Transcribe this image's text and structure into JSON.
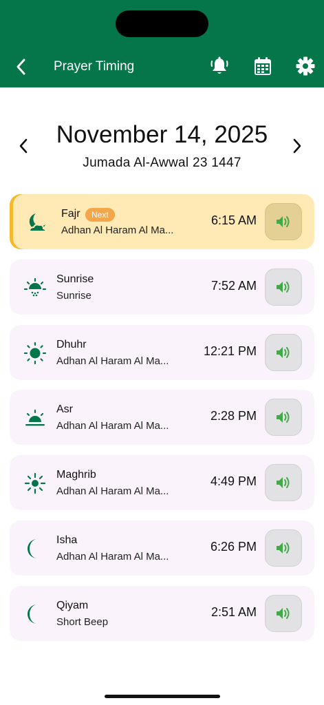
{
  "header": {
    "title": "Prayer Timing",
    "icons": [
      "back-arrow-icon",
      "bell-icon",
      "calendar-icon",
      "gear-icon"
    ]
  },
  "date": {
    "gregorian": "November 14, 2025",
    "hijri": "Jumada Al-Awwal 23 1447"
  },
  "prayers": [
    {
      "name": "Fajr",
      "badge": "Next",
      "sound": "Adhan Al Haram Al Ma...",
      "time": "6:15 AM",
      "icon": "moon-cloud-icon"
    },
    {
      "name": "Sunrise",
      "sound": "Sunrise",
      "time": "7:52 AM",
      "icon": "sunrise-icon"
    },
    {
      "name": "Dhuhr",
      "sound": "Adhan Al Haram Al Ma...",
      "time": "12:21 PM",
      "icon": "sun-icon"
    },
    {
      "name": "Asr",
      "sound": "Adhan Al Haram Al Ma...",
      "time": "2:28 PM",
      "icon": "sun-horizon-icon"
    },
    {
      "name": "Maghrib",
      "sound": "Adhan Al Haram Al Ma...",
      "time": "4:49 PM",
      "icon": "sun-outline-icon"
    },
    {
      "name": "Isha",
      "sound": "Adhan Al Haram Al Ma...",
      "time": "6:26 PM",
      "icon": "crescent-moon-icon"
    },
    {
      "name": "Qiyam",
      "sound": "Short Beep",
      "time": "2:51 AM",
      "icon": "crescent-moon-icon"
    }
  ],
  "colors": {
    "brand_green": "#05754a",
    "highlight": "#ffe9b5",
    "badge": "#f4a64a",
    "sound_icon": "#43a84a"
  }
}
